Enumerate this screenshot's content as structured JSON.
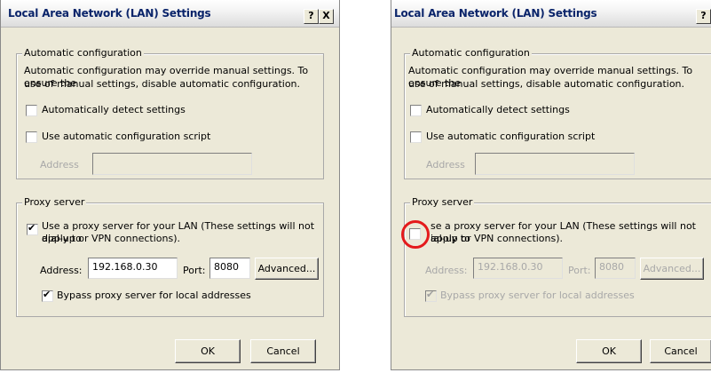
{
  "dialog_title": "Local Area Network (LAN) Settings",
  "help_button": "?",
  "close_button": "X",
  "auto_config": {
    "legend": "Automatic configuration",
    "description_line1": "Automatic configuration may override manual settings.  To ensure the",
    "description_line2": "use of manual settings, disable automatic configuration.",
    "detect_label": "Automatically detect settings",
    "script_label": "Use automatic configuration script",
    "address_label": "Address"
  },
  "proxy": {
    "legend": "Proxy server",
    "use_proxy_line1": "Use a proxy server for your LAN (These settings will not apply to",
    "use_proxy_line2": "dial-up or VPN connections).",
    "use_proxy_line1_right": "se a proxy server for your LAN (These settings will not apply to",
    "use_proxy_line2_right": "ial-up or VPN connections).",
    "address_label": "Address:",
    "address_value": "192.168.0.30",
    "port_label": "Port:",
    "port_value": "8080",
    "advanced_button": "Advanced...",
    "bypass_label": "Bypass proxy server for local addresses"
  },
  "ok_button": "OK",
  "cancel_button": "Cancel",
  "state": {
    "left": {
      "use_proxy_checked": true,
      "bypass_checked": true,
      "proxy_fields_enabled": true
    },
    "right": {
      "use_proxy_checked": false,
      "bypass_checked": true,
      "proxy_fields_enabled": false
    }
  },
  "colors": {
    "dialog_bg": "#ece9d8",
    "title_text": "#0a246a",
    "highlight_circle": "#e41a1c"
  }
}
